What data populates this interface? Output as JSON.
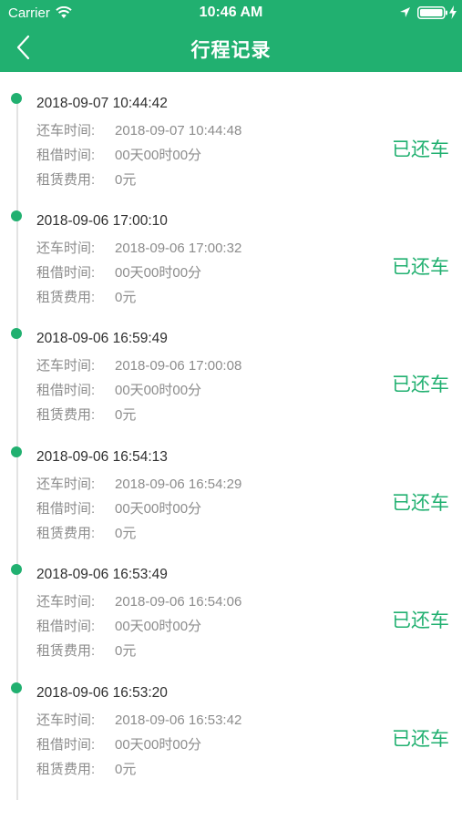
{
  "status_bar": {
    "carrier": "Carrier",
    "time": "10:46 AM"
  },
  "nav": {
    "title": "行程记录"
  },
  "labels": {
    "return_time": "还车时间:",
    "rental_duration": "租借时间:",
    "rental_fee": "租赁费用:"
  },
  "colors": {
    "primary": "#21b070",
    "muted_text": "#8c8c8c",
    "timeline": "#e3e3e3"
  },
  "icons": {
    "back": "chevron-left-icon",
    "wifi": "wifi-icon",
    "location": "location-arrow-icon",
    "battery": "battery-icon"
  },
  "trips": [
    {
      "start_time": "2018-09-07 10:44:42",
      "return_time": "2018-09-07 10:44:48",
      "duration": "00天00时00分",
      "fee": "0元",
      "status": "已还车"
    },
    {
      "start_time": "2018-09-06 17:00:10",
      "return_time": "2018-09-06 17:00:32",
      "duration": "00天00时00分",
      "fee": "0元",
      "status": "已还车"
    },
    {
      "start_time": "2018-09-06 16:59:49",
      "return_time": "2018-09-06 17:00:08",
      "duration": "00天00时00分",
      "fee": "0元",
      "status": "已还车"
    },
    {
      "start_time": "2018-09-06 16:54:13",
      "return_time": "2018-09-06 16:54:29",
      "duration": "00天00时00分",
      "fee": "0元",
      "status": "已还车"
    },
    {
      "start_time": "2018-09-06 16:53:49",
      "return_time": "2018-09-06 16:54:06",
      "duration": "00天00时00分",
      "fee": "0元",
      "status": "已还车"
    },
    {
      "start_time": "2018-09-06 16:53:20",
      "return_time": "2018-09-06 16:53:42",
      "duration": "00天00时00分",
      "fee": "0元",
      "status": "已还车"
    }
  ]
}
